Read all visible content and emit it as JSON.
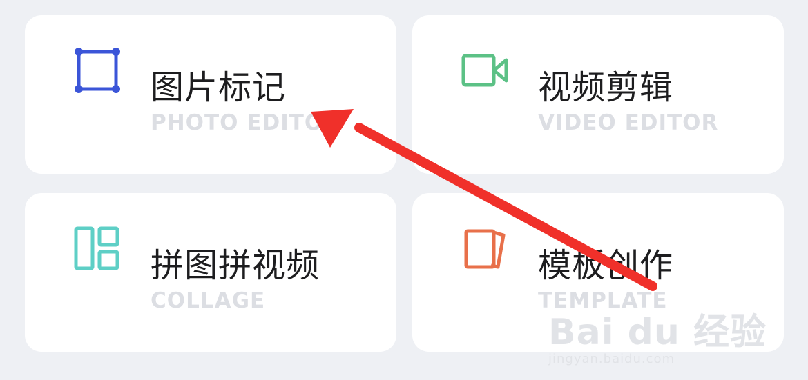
{
  "menu": {
    "items": [
      {
        "title": "图片标记",
        "subtitle": "PHOTO EDITOR",
        "icon": "crop-frame-icon",
        "color": "#3b55d8"
      },
      {
        "title": "视频剪辑",
        "subtitle": "VIDEO EDITOR",
        "icon": "video-camera-icon",
        "color": "#5cc186"
      },
      {
        "title": "拼图拼视频",
        "subtitle": "COLLAGE",
        "icon": "collage-grid-icon",
        "color": "#5ecfc6"
      },
      {
        "title": "模板创作",
        "subtitle": "TEMPLATE",
        "icon": "template-cards-icon",
        "color": "#e8704a"
      }
    ]
  },
  "annotation": {
    "arrow_color": "#f0302a"
  },
  "watermark": {
    "logo": "Bai du 经验",
    "site": "jingyan.baidu.com"
  }
}
